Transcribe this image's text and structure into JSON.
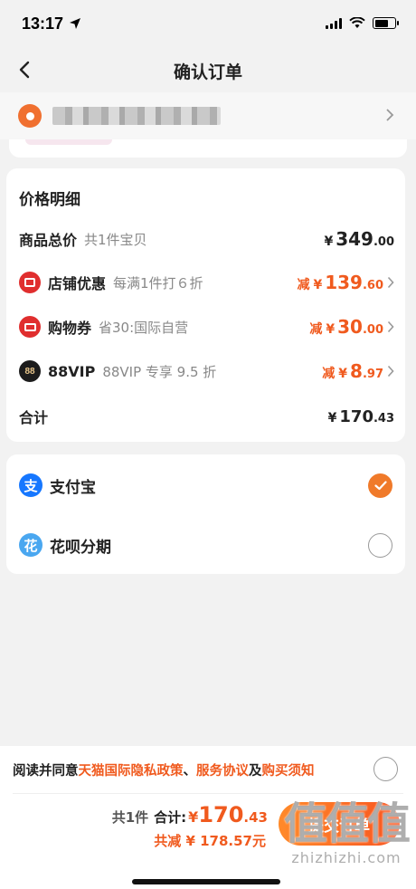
{
  "status": {
    "time": "13:17"
  },
  "nav": {
    "title": "确认订单"
  },
  "price_card": {
    "title": "价格明细",
    "rows": [
      {
        "label": "商品总价",
        "sub": "共1件宝贝",
        "prefix": "",
        "yen": "¥",
        "int": "349",
        "dec": ".00"
      },
      {
        "label": "店铺优惠",
        "sub": "每满1件打６折",
        "prefix": "减",
        "yen": "¥",
        "int": "139",
        "dec": ".60",
        "icon": "shop-icon"
      },
      {
        "label": "购物券",
        "sub": "省30:国际自营",
        "prefix": "减",
        "yen": "¥",
        "int": "30",
        "dec": ".00",
        "icon": "coupon-icon"
      },
      {
        "label": "88VIP",
        "sub": "88VIP 专享 9.5 折",
        "prefix": "减",
        "yen": "¥",
        "int": "8",
        "dec": ".97",
        "icon": "88vip-icon",
        "icon_text": "88"
      },
      {
        "label": "合计",
        "sub": "",
        "prefix": "",
        "yen": "¥",
        "int": "170",
        "dec": ".43"
      }
    ]
  },
  "payment": {
    "options": [
      {
        "label": "支付宝",
        "icon_text": "支",
        "selected": true
      },
      {
        "label": "花呗分期",
        "icon_text": "花",
        "selected": false
      }
    ]
  },
  "bottom": {
    "agree_prefix": "阅读并同意",
    "link_privacy": "天猫国际隐私政策",
    "sep": "、",
    "link_service": "服务协议",
    "and": "及",
    "link_notice": "购买须知",
    "count": "共1件",
    "total_label": "合计:",
    "total_yen": "¥",
    "total_int": "170",
    "total_dec": ".43",
    "saved": "共减 ¥ 178.57元",
    "submit": "提交订单"
  },
  "watermark": {
    "big": "值值值",
    "small": "zhizhizhi.com"
  },
  "colors": {
    "accent": "#f05a1e",
    "alipay": "#1677ff",
    "check": "#f07a2a"
  }
}
